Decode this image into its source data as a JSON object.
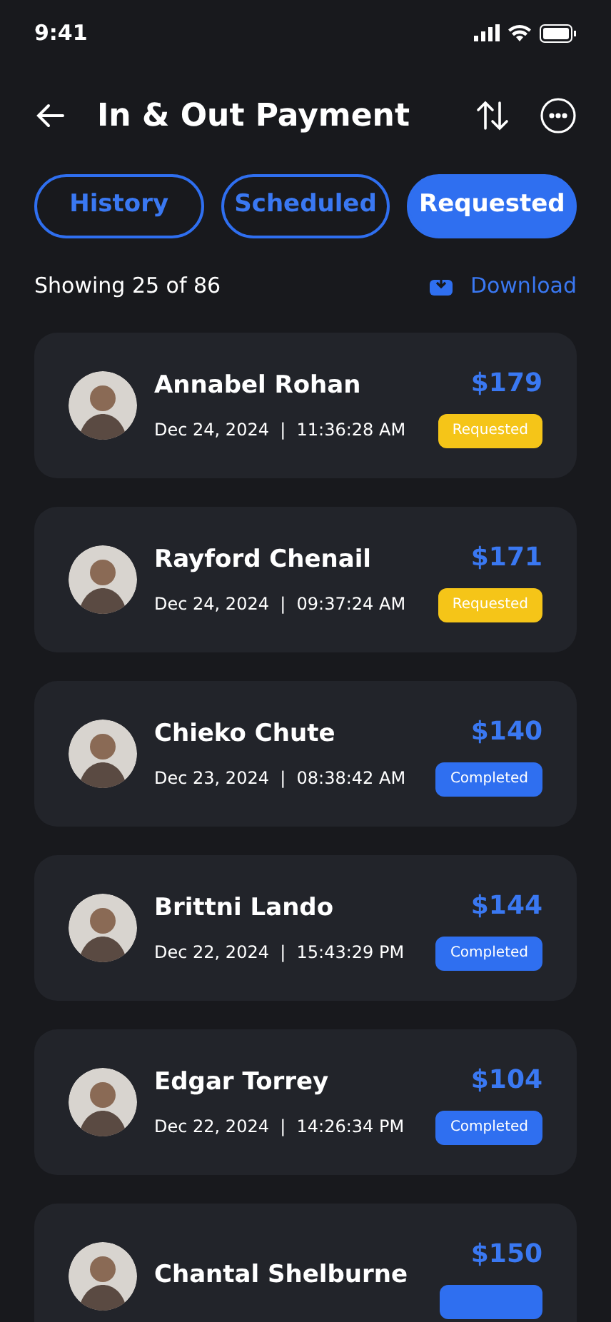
{
  "status_bar": {
    "time": "9:41"
  },
  "header": {
    "title": "In & Out Payment"
  },
  "tabs": [
    {
      "label": "History",
      "selected": false
    },
    {
      "label": "Scheduled",
      "selected": false
    },
    {
      "label": "Requested",
      "selected": true
    }
  ],
  "summary": {
    "text": "Showing 25 of 86",
    "download": "Download"
  },
  "payments": [
    {
      "name": "Annabel Rohan",
      "datetime": "Dec 24, 2024  |  11:36:28 AM",
      "amount": "$179",
      "kind": "requested",
      "status_label": "Requested"
    },
    {
      "name": "Rayford Chenail",
      "datetime": "Dec 24, 2024  |  09:37:24 AM",
      "amount": "$171",
      "kind": "requested",
      "status_label": "Requested"
    },
    {
      "name": "Chieko Chute",
      "datetime": "Dec 23, 2024  |  08:38:42 AM",
      "amount": "$140",
      "kind": "completed",
      "status_label": "Completed"
    },
    {
      "name": "Brittni Lando",
      "datetime": "Dec 22, 2024  |  15:43:29 PM",
      "amount": "$144",
      "kind": "completed",
      "status_label": "Completed"
    },
    {
      "name": "Edgar Torrey",
      "datetime": "Dec 22, 2024  |  14:26:34 PM",
      "amount": "$104",
      "kind": "completed",
      "status_label": "Completed"
    },
    {
      "name": "Chantal Shelburne",
      "amount": "$150",
      "kind": "completed"
    }
  ]
}
